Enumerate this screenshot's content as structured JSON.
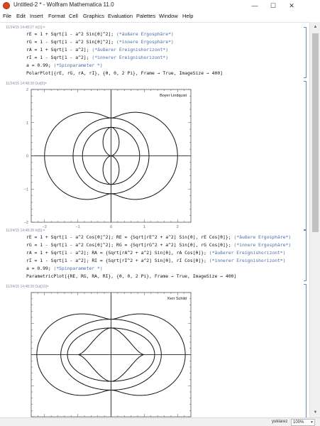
{
  "window": {
    "title": "Untitled-2 * - Wolfram Mathematica 11.0",
    "controls": [
      "—",
      "☐",
      "✕"
    ]
  },
  "menu": [
    "File",
    "Edit",
    "Insert",
    "Format",
    "Cell",
    "Graphics",
    "Evaluation",
    "Palettes",
    "Window",
    "Help"
  ],
  "cells": [
    {
      "label": "11/24/15 14:48:27 In[1]:=",
      "lines": [
        {
          "code": "rE = 1 + Sqrt[1 - a^2 Sin[θ]^2]; ",
          "comment": "(*äußere Ergosphäre*)"
        },
        {
          "code": "rG = 1 - Sqrt[1 - a^2 Sin[θ]^2]; ",
          "comment": "(*innere Ergosphäre*)"
        },
        {
          "code": "rA = 1 + Sqrt[1 - a^2]; ",
          "comment": "(*äußerer Ereignishorizont*)"
        },
        {
          "code": "rI = 1 - Sqrt[1 - a^2]; ",
          "comment": "(*innerer Ereignishorizont*)"
        },
        {
          "code": "a = 0.99; ",
          "comment": "(*Spinparameter *)"
        },
        {
          "code": "PolarPlot[{rE, rG, rA, rI}, {θ, 0, 2 Pi}, Frame → True, ImageSize → 400]",
          "comment": ""
        }
      ]
    },
    {
      "label": "11/24/15 14:48:28 In[5]:=",
      "lines": [
        {
          "code": "rE = 1 + Sqrt[1 - a^2 Cos[θ]^2]; RE = {Sqrt[rE^2 + a^2] Sin[θ], rE Cos[θ]}; ",
          "comment": "(*äußere Ergosphäre*)"
        },
        {
          "code": "rG = 1 - Sqrt[1 - a^2 Cos[θ]^2]; RG = {Sqrt[rG^2 + a^2] Sin[θ], rG Cos[θ]}; ",
          "comment": "(*innere Ergosphäre*)"
        },
        {
          "code": "rA = 1 + Sqrt[1 - a^2]; RA = {Sqrt[rA^2 + a^2] Sin[θ], rA Cos[θ]}; ",
          "comment": "(*äußerer Ereignishorizont*)"
        },
        {
          "code": "rI = 1 - Sqrt[1 - a^2]; RI = {Sqrt[rI^2 + a^2] Sin[θ], rI Cos[θ]}; ",
          "comment": "(*innerer Ereignishorizont*)"
        },
        {
          "code": "a = 0.99; ",
          "comment": "(*Spinparameter *)"
        },
        {
          "code": "ParametricPlot[{RE, RG, RA, RI}, {θ, 0, 2 Pi}, Frame → True, ImageSize → 400]",
          "comment": ""
        }
      ]
    }
  ],
  "outputs": [
    {
      "label": "11/24/15 14:48:28 Out[6]=",
      "annotation": "Boyer Lindquist"
    },
    {
      "label": "11/24/15 14:48:28 Out[10]=",
      "annotation": "Kerr Schild"
    }
  ],
  "chart_data": [
    {
      "type": "line",
      "plot_kind": "polar",
      "annotation": "Boyer Lindquist",
      "spin_parameter": 0.99,
      "xlim": [
        -2.4,
        2.4
      ],
      "ylim": [
        -2.0,
        2.0
      ],
      "xticks": [
        "-2",
        "-1",
        "0",
        "1",
        "2"
      ],
      "yticks": [
        "2",
        "1",
        "0",
        "-1",
        "-2"
      ],
      "frame": true,
      "series": []
    },
    {
      "type": "line",
      "plot_kind": "parametric",
      "annotation": "Kerr Schild",
      "spin_parameter": 0.99,
      "xlim": [
        -2.4,
        2.4
      ],
      "ylim": [
        -2.0,
        2.0
      ],
      "frame": true,
      "series": []
    }
  ],
  "statusbar": {
    "label": "yuklarez",
    "zoom": "100%"
  }
}
